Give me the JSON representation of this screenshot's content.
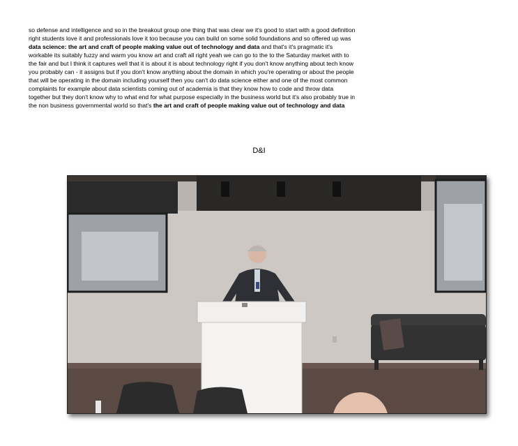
{
  "transcript": {
    "seg1": "so defense and intelligence and so in the breakout group one thing that was clear we it's good to start with a good definition right students love it and professionals love it too because you can build on some solid foundations and so offered up was ",
    "bold1": "data science: the art and craft of people making value out of technology and data",
    "seg2": " and that's it's pragmatic it's workable its suitably fuzzy and warm you know art and craft all right yeah we can go to the to the Saturday market with to the fair and but I think it captures well that it is about it is about technology right if you don't know anything about tech know you probably can - it assigns but if you don't know anything about the domain in which you're operating or about the people that will be operating in the domain including yourself then you can't do data science either and one of the most common complaints for example about data scientists coming out of academia is that they know how to code and throw data together but they don't know why to what end for what purpose especially in the business world but it's also probably true in the non business governmental world so that's ",
    "bold2": "the art and craft of people making value out of technology and data"
  },
  "section_label": "D&I",
  "video": {
    "description_icon": "presenter-at-podium-video"
  }
}
